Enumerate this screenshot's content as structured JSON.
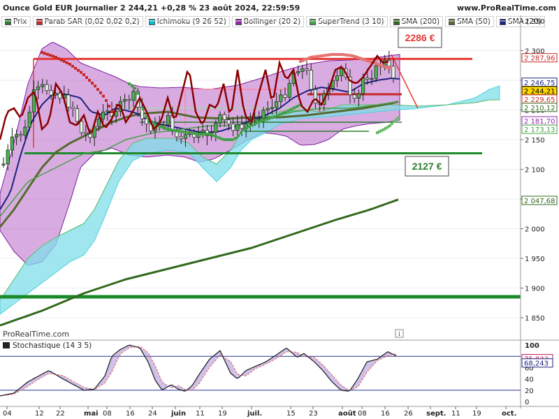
{
  "header": {
    "title": "Ounce Gold EUR Journalier 2 244,21 +0,28 % 23 août 2024, 22:59:59",
    "site": "www.ProRealTime.com"
  },
  "indicators": [
    {
      "label": "Prix",
      "color": "#2e7d32"
    },
    {
      "label": "Parab SAR (0,02 0,02 0,2)",
      "color": "#c62828"
    },
    {
      "label": "Ichimoku (9 26 52)",
      "color": "#00bcd4"
    },
    {
      "label": "Bollinger (20 2)",
      "color": "#8e24aa"
    },
    {
      "label": "SuperTrend (3 10)",
      "color": "#43a047"
    },
    {
      "label": "SMA (200)",
      "color": "#33691e"
    },
    {
      "label": "SMA (50)",
      "color": "#556b2f"
    },
    {
      "label": "SMA (20)",
      "color": "#1a237e"
    }
  ],
  "watermark": "ProRealTime.com",
  "stoch_label": "Stochastique (14 3 5)",
  "chart_data": {
    "type": "candlestick",
    "y_ticks": [
      "2 350",
      "2 300",
      "2 250",
      "2 200",
      "2 150",
      "2 100",
      "2 050",
      "2 000",
      "1 950",
      "1 900",
      "1 850"
    ],
    "x_ticks": [
      "04",
      "12",
      "22",
      "mai",
      "08",
      "16",
      "24",
      "juin",
      "11",
      "19",
      "juil.",
      "15",
      "23",
      "août",
      "08",
      "16",
      "26",
      "sept.",
      "11",
      "19",
      "oct."
    ],
    "price_labels": [
      {
        "text": "2 287,96",
        "value": 2287.96,
        "color": "#c62828"
      },
      {
        "text": "2 246,75",
        "value": 2246.75,
        "color": "#1a237e"
      },
      {
        "text": "2 244,21",
        "value": 2244.21,
        "color": "#000000",
        "bg": "#ffd600"
      },
      {
        "text": "2 229,65",
        "value": 2229.65,
        "color": "#c62828"
      },
      {
        "text": "2 210,12",
        "value": 2210.12,
        "color": "#33691e"
      },
      {
        "text": "2 181,70",
        "value": 2181.7,
        "color": "#8e24aa"
      },
      {
        "text": "2 173,13",
        "value": 2173.13,
        "color": "#43a047"
      },
      {
        "text": "2 047,68",
        "value": 2047.68,
        "color": "#33691e"
      }
    ],
    "annotations": [
      {
        "text": "2286 €",
        "value": 2286,
        "color": "#e53935"
      },
      {
        "text": "2127 €",
        "value": 2127,
        "color": "#2e7d32"
      }
    ],
    "stoch_ticks": [
      "100",
      "80",
      "60",
      "40",
      "20",
      "0"
    ],
    "stoch_labels": [
      {
        "text": "75,833",
        "value": 75.833,
        "color": "#c2185b"
      },
      {
        "text": "68,243",
        "value": 68.243,
        "color": "#1a237e"
      }
    ]
  }
}
